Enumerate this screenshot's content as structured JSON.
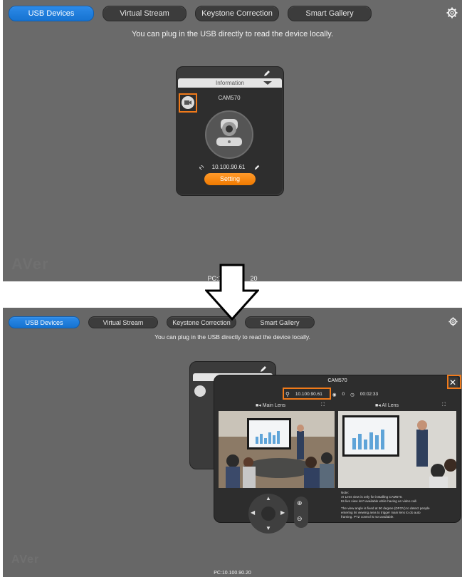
{
  "tabs": [
    {
      "label": "USB Devices",
      "active": true
    },
    {
      "label": "Virtual Stream",
      "active": false
    },
    {
      "label": "Keystone Correction",
      "active": false
    },
    {
      "label": "Smart Gallery",
      "active": false
    }
  ],
  "subtitle": "You can plug in the USB directly to read the device locally.",
  "pc_label_top": "PC:1",
  "pc_label_top_suffix": "20",
  "pc_label_bottom": "PC:10.100.90.20",
  "device": {
    "info_label": "Information",
    "name": "CAM570",
    "ip": "10.100.90.61",
    "setting_label": "Setting"
  },
  "dialog": {
    "title": "CAM570",
    "ip": "10.100.90.61",
    "viewers": "0",
    "time": "00:02:33",
    "main_lens": "Main Lens",
    "ai_lens": "AI Lens",
    "note_lines": [
      "Note:",
      "AI Lens view is only for installing CAM570.",
      "Its live view isn't available while having an video call.",
      "",
      "The view angle is fixed at 90 degree (DFOV) to detect people",
      "entering its viewing area to trigger main lens to do auto",
      "framing. PTZ control is not available."
    ]
  },
  "icons": {
    "settings": "gear-icon",
    "edit": "pencil-icon",
    "camera": "video-camera-icon",
    "link": "link-icon",
    "close": "close-icon",
    "location": "location-pin-icon",
    "user": "user-icon",
    "clock": "clock-icon",
    "zoom_in": "zoom-in-icon",
    "zoom_out": "zoom-out-icon",
    "arrow": "down-arrow-icon"
  },
  "colors": {
    "accent": "#1a7ad9",
    "highlight": "#f07a1a",
    "setting_button": "#f7890e"
  }
}
